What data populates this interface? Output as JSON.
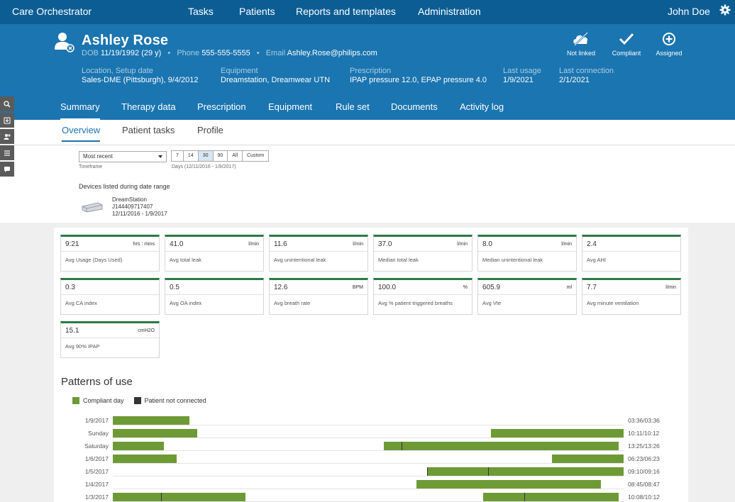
{
  "app": {
    "title": "Care Orchestrator",
    "user": "John Doe"
  },
  "nav": [
    "Tasks",
    "Patients",
    "Reports and templates",
    "Administration"
  ],
  "patient": {
    "name": "Ashley Rose",
    "dob_label": "DOB",
    "dob": "11/19/1992 (29 y)",
    "phone_label": "Phone",
    "phone": "555-555-5555",
    "email_label": "Email",
    "email": "Ashley.Rose@philips.com"
  },
  "facts": [
    {
      "label": "Location, Setup date",
      "value": "Sales-DME (Pittsburgh), 9/4/2012"
    },
    {
      "label": "Equipment",
      "value": "Dreamstation, Dreamwear UTN"
    },
    {
      "label": "Prescription",
      "value": "IPAP pressure 12.0, EPAP pressure 4.0"
    },
    {
      "label": "Last usage",
      "value": "1/9/2021"
    },
    {
      "label": "Last connection",
      "value": "2/1/2021"
    }
  ],
  "statuses": [
    {
      "label": "Not linked",
      "icon": "cloud-off-icon"
    },
    {
      "label": "Compliant",
      "icon": "check-icon"
    },
    {
      "label": "Assigned",
      "icon": "plus-circle-icon"
    }
  ],
  "tabs": [
    "Summary",
    "Therapy data",
    "Prescription",
    "Equipment",
    "Rule set",
    "Documents",
    "Activity log"
  ],
  "subtabs": [
    "Overview",
    "Patient tasks",
    "Profile"
  ],
  "filters": {
    "timeframe_value": "Most recent",
    "timeframe_label": "Timeframe",
    "days_options": [
      "7",
      "14",
      "30",
      "90",
      "All",
      "Custom"
    ],
    "days_selected": "30",
    "days_label": "Days (12/11/2016 - 1/9/2017)"
  },
  "devices": {
    "title": "Devices listed during date range",
    "name": "DreamStation",
    "serial": "J144409717407",
    "range": "12/11/2016 - 1/9/2017"
  },
  "metrics": [
    {
      "value": "9:21",
      "unit": "hrs : mins",
      "label": "Avg Usage (Days Used)"
    },
    {
      "value": "41.0",
      "unit": "l/min",
      "label": "Avg total leak"
    },
    {
      "value": "11.6",
      "unit": "l/min",
      "label": "Avg unintentional leak"
    },
    {
      "value": "37.0",
      "unit": "l/min",
      "label": "Median total leak"
    },
    {
      "value": "8.0",
      "unit": "l/min",
      "label": "Median unintentional leak"
    },
    {
      "value": "2.4",
      "unit": "",
      "label": "Avg AHI"
    },
    {
      "value": "0.3",
      "unit": "",
      "label": "Avg CA index"
    },
    {
      "value": "0.5",
      "unit": "",
      "label": "Avg OA index"
    },
    {
      "value": "12.6",
      "unit": "BPM",
      "label": "Avg breath rate"
    },
    {
      "value": "100.0",
      "unit": "%",
      "label": "Avg % patient triggered breaths"
    },
    {
      "value": "605.9",
      "unit": "ml",
      "label": "Avg Vte"
    },
    {
      "value": "7.7",
      "unit": "l/min",
      "label": "Avg minute ventilation"
    },
    {
      "value": "15.1",
      "unit": "cmH2O",
      "label": "Avg 90% IPAP"
    }
  ],
  "patterns": {
    "title": "Patterns of use",
    "legend": [
      {
        "label": "Compliant day",
        "color": "#6e9a36"
      },
      {
        "label": "Patient not connected",
        "color": "#333333"
      }
    ],
    "rows": [
      {
        "day": "1/9/2017",
        "time": "03:36/03:36",
        "segments": [
          [
            0.0,
            0.15
          ]
        ],
        "ticks": []
      },
      {
        "day": "Sunday",
        "time": "10:11/10:12",
        "segments": [
          [
            0.0,
            0.165
          ],
          [
            0.74,
            1.0
          ]
        ],
        "ticks": []
      },
      {
        "day": "Saturday",
        "time": "13:25/13:26",
        "segments": [
          [
            0.0,
            0.1
          ],
          [
            0.53,
            0.99
          ]
        ],
        "ticks": [
          0.565
        ]
      },
      {
        "day": "1/6/2017",
        "time": "06:23/06:23",
        "segments": [
          [
            0.0,
            0.125
          ],
          [
            0.86,
            1.0
          ]
        ],
        "ticks": []
      },
      {
        "day": "1/5/2017",
        "time": "09:10/09:16",
        "segments": [
          [
            0.615,
            1.0
          ]
        ],
        "ticks": [
          0.615,
          0.735
        ]
      },
      {
        "day": "1/4/2017",
        "time": "08:45/08:47",
        "segments": [
          [
            0.595,
            0.955
          ]
        ],
        "ticks": []
      },
      {
        "day": "1/3/2017",
        "time": "10:08/10:12",
        "segments": [
          [
            0.0,
            0.26
          ],
          [
            0.725,
            0.99
          ]
        ],
        "ticks": [
          0.095,
          0.805
        ]
      }
    ]
  }
}
